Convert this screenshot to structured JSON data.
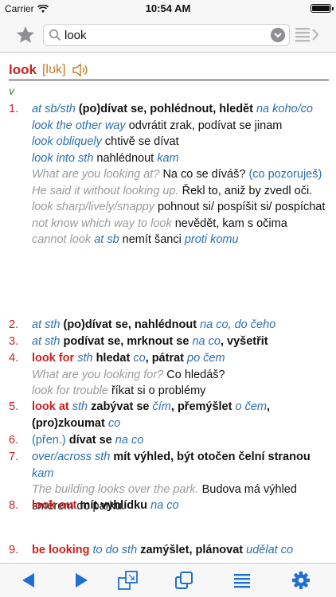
{
  "status": {
    "carrier": "Carrier",
    "time": "10:54 AM",
    "battery_level": 1.0
  },
  "search": {
    "value": "look",
    "placeholder": ""
  },
  "entry": {
    "headword": "look",
    "ipa": "[lʊk]",
    "pos": "v",
    "senses": [
      {
        "num": "1.",
        "lines": [
          [
            {
              "c": "it-blue",
              "t": "at sb/sth "
            },
            {
              "c": "bold",
              "t": "(po)dívat se, pohlédnout, hledět "
            },
            {
              "c": "it-blue",
              "t": "na koho/co"
            }
          ],
          [
            {
              "c": "it-blue",
              "t": "look the other way "
            },
            {
              "c": "plain",
              "t": "odvrátit zrak, podívat se jinam"
            }
          ],
          [
            {
              "c": "it-blue",
              "t": "look obliquely "
            },
            {
              "c": "plain",
              "t": "chtivě se dívat"
            }
          ],
          [
            {
              "c": "it-blue",
              "t": "look into sth "
            },
            {
              "c": "plain",
              "t": "nahlédnout "
            },
            {
              "c": "it-blue",
              "t": "kam"
            }
          ],
          [
            {
              "c": "it-gray",
              "t": "What are you looking at? "
            },
            {
              "c": "plain",
              "t": "Na co se díváš? "
            },
            {
              "c": "blue",
              "t": "(co pozoruješ)"
            }
          ],
          [
            {
              "c": "it-gray",
              "t": "He said it without looking up. "
            },
            {
              "c": "plain",
              "t": "Řekl to, aniž by zvedl oči."
            }
          ],
          [
            {
              "c": "it-gray",
              "t": "look sharp/lively/snappy "
            },
            {
              "c": "plain",
              "t": "pohnout si/ pospíšit si/ pospíchat"
            }
          ],
          [
            {
              "c": "it-gray",
              "t": "not know which way to look "
            },
            {
              "c": "plain",
              "t": "nevědět, kam s očima"
            }
          ],
          [
            {
              "c": "it-gray",
              "t": "cannot look "
            },
            {
              "c": "it-blue",
              "t": "at sb "
            },
            {
              "c": "plain",
              "t": "nemít šanci "
            },
            {
              "c": "it-blue",
              "t": "proti komu"
            }
          ]
        ]
      },
      {
        "num": "2.",
        "lines": [
          [
            {
              "c": "it-blue",
              "t": "at sth "
            },
            {
              "c": "bold",
              "t": "(po)dívat se, nahlédnout "
            },
            {
              "c": "it-blue",
              "t": "na co, do čeho"
            }
          ]
        ]
      },
      {
        "num": "3.",
        "lines": [
          [
            {
              "c": "it-blue",
              "t": "at sth "
            },
            {
              "c": "bold",
              "t": "podívat se, mrknout se "
            },
            {
              "c": "it-blue",
              "t": "na co"
            },
            {
              "c": "bold",
              "t": ", vyšetřit"
            }
          ]
        ]
      },
      {
        "num": "4.",
        "lines": [
          [
            {
              "c": "red-b",
              "t": "look for "
            },
            {
              "c": "it-blue",
              "t": "sth "
            },
            {
              "c": "bold",
              "t": "hledat "
            },
            {
              "c": "it-blue",
              "t": "co"
            },
            {
              "c": "bold",
              "t": ", pátrat "
            },
            {
              "c": "it-blue",
              "t": "po čem"
            }
          ],
          [
            {
              "c": "it-gray",
              "t": "What are you looking for? "
            },
            {
              "c": "plain",
              "t": "Co hledáš?"
            }
          ],
          [
            {
              "c": "it-gray",
              "t": "look for trouble "
            },
            {
              "c": "plain",
              "t": "říkat si o problémy"
            }
          ]
        ]
      },
      {
        "num": "5.",
        "lines": [
          [
            {
              "c": "red-b",
              "t": "look at "
            },
            {
              "c": "it-blue",
              "t": "sth "
            },
            {
              "c": "bold",
              "t": "zabývat se "
            },
            {
              "c": "it-blue",
              "t": "čím"
            },
            {
              "c": "bold",
              "t": ", přemýšlet "
            },
            {
              "c": "it-blue",
              "t": "o čem"
            },
            {
              "c": "bold",
              "t": ", (pro)zkoumat "
            },
            {
              "c": "it-blue",
              "t": "co"
            }
          ]
        ]
      },
      {
        "num": "6.",
        "lines": [
          [
            {
              "c": "blue",
              "t": "(přen.) "
            },
            {
              "c": "bold",
              "t": "dívat se "
            },
            {
              "c": "it-blue",
              "t": "na co"
            }
          ]
        ]
      },
      {
        "num": "7.",
        "lines": [
          [
            {
              "c": "it-blue",
              "t": "over/across sth "
            },
            {
              "c": "bold",
              "t": "mít výhled, být otočen čelní stranou "
            },
            {
              "c": "it-blue",
              "t": "kam"
            }
          ],
          [
            {
              "c": "it-gray",
              "t": "The building looks over the park. "
            },
            {
              "c": "plain",
              "t": "Budova má výhled směrem do parku."
            }
          ]
        ]
      },
      {
        "num": "8.",
        "lines": [
          [
            {
              "c": "red-b",
              "t": "look out "
            },
            {
              "c": "bold",
              "t": "mít vyhlídku "
            },
            {
              "c": "it-blue",
              "t": "na co"
            }
          ]
        ]
      },
      {
        "num": "9.",
        "lines": [
          [
            {
              "c": "red-b",
              "t": "be looking "
            },
            {
              "c": "it-blue",
              "t": "to do sth "
            },
            {
              "c": "bold",
              "t": "zamýšlet, plánovat "
            },
            {
              "c": "it-blue",
              "t": "udělat co"
            }
          ]
        ]
      }
    ]
  },
  "toolbar": {
    "items": [
      "back-icon",
      "forward-icon",
      "cards-icon",
      "copy-icon",
      "list-icon",
      "settings-icon"
    ],
    "accent": "#1f6fd0"
  }
}
